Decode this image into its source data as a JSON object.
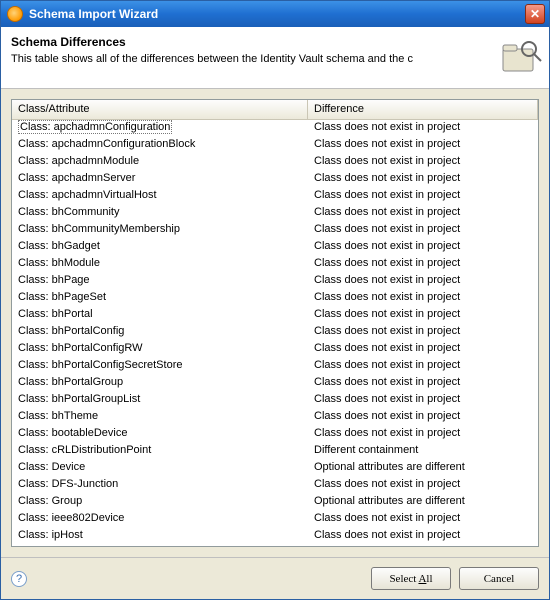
{
  "window": {
    "title": "Schema Import Wizard"
  },
  "header": {
    "title": "Schema Differences",
    "description": "This table shows all of the differences between the Identity Vault schema and the c"
  },
  "table": {
    "columns": {
      "class_attr": "Class/Attribute",
      "difference": "Difference"
    },
    "rows": [
      {
        "name": "Class: apchadmnConfiguration",
        "diff": "Class does not exist in project"
      },
      {
        "name": "Class: apchadmnConfigurationBlock",
        "diff": "Class does not exist in project"
      },
      {
        "name": "Class: apchadmnModule",
        "diff": "Class does not exist in project"
      },
      {
        "name": "Class: apchadmnServer",
        "diff": "Class does not exist in project"
      },
      {
        "name": "Class: apchadmnVirtualHost",
        "diff": "Class does not exist in project"
      },
      {
        "name": "Class: bhCommunity",
        "diff": "Class does not exist in project"
      },
      {
        "name": "Class: bhCommunityMembership",
        "diff": "Class does not exist in project"
      },
      {
        "name": "Class: bhGadget",
        "diff": "Class does not exist in project"
      },
      {
        "name": "Class: bhModule",
        "diff": "Class does not exist in project"
      },
      {
        "name": "Class: bhPage",
        "diff": "Class does not exist in project"
      },
      {
        "name": "Class: bhPageSet",
        "diff": "Class does not exist in project"
      },
      {
        "name": "Class: bhPortal",
        "diff": "Class does not exist in project"
      },
      {
        "name": "Class: bhPortalConfig",
        "diff": "Class does not exist in project"
      },
      {
        "name": "Class: bhPortalConfigRW",
        "diff": "Class does not exist in project"
      },
      {
        "name": "Class: bhPortalConfigSecretStore",
        "diff": "Class does not exist in project"
      },
      {
        "name": "Class: bhPortalGroup",
        "diff": "Class does not exist in project"
      },
      {
        "name": "Class: bhPortalGroupList",
        "diff": "Class does not exist in project"
      },
      {
        "name": "Class: bhTheme",
        "diff": "Class does not exist in project"
      },
      {
        "name": "Class: bootableDevice",
        "diff": "Class does not exist in project"
      },
      {
        "name": "Class: cRLDistributionPoint",
        "diff": "Different containment"
      },
      {
        "name": "Class: Device",
        "diff": "Optional attributes are different"
      },
      {
        "name": "Class: DFS-Junction",
        "diff": "Class does not exist in project"
      },
      {
        "name": "Class: Group",
        "diff": "Optional attributes are different"
      },
      {
        "name": "Class: ieee802Device",
        "diff": "Class does not exist in project"
      },
      {
        "name": "Class: ipHost",
        "diff": "Class does not exist in project"
      }
    ]
  },
  "footer": {
    "select_all_label": "Select All",
    "cancel_label": "Cancel",
    "help_char": "?"
  }
}
